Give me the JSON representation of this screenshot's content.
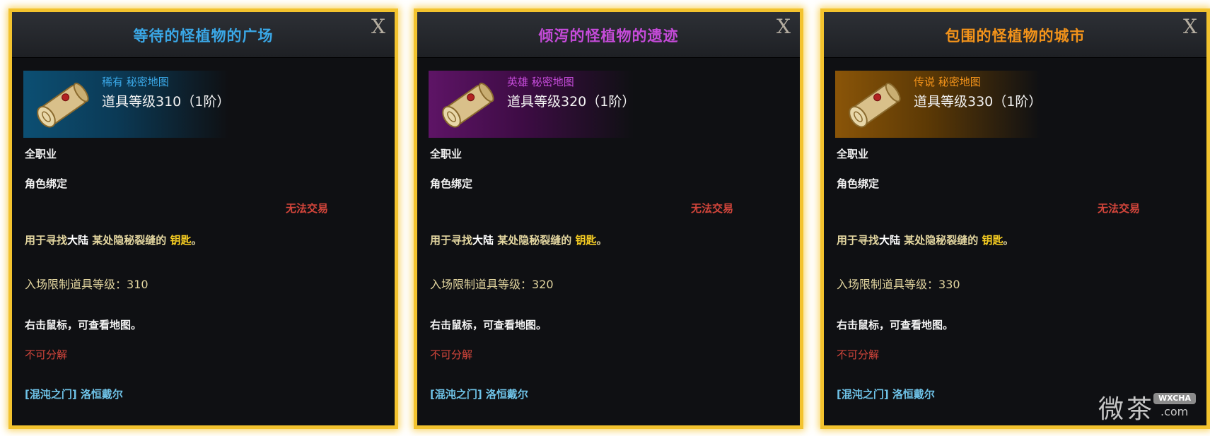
{
  "colors": {
    "frame": "#f3c32e",
    "panel_bg": "#0f1013",
    "rare": "#3aa7e6",
    "heroic": "#c54bd9",
    "legendary": "#f3931a",
    "untradeable": "#d2453b",
    "highlight": "#f5cc22",
    "location": "#6fc3e8"
  },
  "cards": [
    {
      "title": "等待的怪植物的广场",
      "title_color": "#3aa7e6",
      "close_label": "X",
      "icon": "scroll-icon",
      "rarity": "稀有",
      "rarity_color": "#3aa7e6",
      "type": "秘密地图",
      "item_level": "道具等级310（1阶）",
      "class": "全职业",
      "binding": "角色绑定",
      "trade": "无法交易",
      "desc_prefix": "用于寻找",
      "desc_place": "大陆",
      "desc_middle": " 某处隐秘裂缝的 ",
      "desc_key": "钥匙",
      "desc_suffix": "。",
      "entry_label": "入场限制道具等级：",
      "entry_value": "310",
      "right_click": "右击鼠标，可查看地图。",
      "dismantle": "不可分解",
      "location": "[混沌之门] 洛恒戴尔"
    },
    {
      "title": "倾泻的怪植物的遗迹",
      "title_color": "#c54bd9",
      "close_label": "X",
      "icon": "scroll-icon",
      "rarity": "英雄",
      "rarity_color": "#c54bd9",
      "type": "秘密地图",
      "item_level": "道具等级320（1阶）",
      "class": "全职业",
      "binding": "角色绑定",
      "trade": "无法交易",
      "desc_prefix": "用于寻找",
      "desc_place": "大陆",
      "desc_middle": " 某处隐秘裂缝的 ",
      "desc_key": "钥匙",
      "desc_suffix": "。",
      "entry_label": "入场限制道具等级：",
      "entry_value": "320",
      "right_click": "右击鼠标，可查看地图。",
      "dismantle": "不可分解",
      "location": "[混沌之门] 洛恒戴尔"
    },
    {
      "title": "包围的怪植物的城市",
      "title_color": "#f3931a",
      "close_label": "X",
      "icon": "scroll-icon",
      "rarity": "传说",
      "rarity_color": "#f3931a",
      "type": "秘密地图",
      "item_level": "道具等级330（1阶）",
      "class": "全职业",
      "binding": "角色绑定",
      "trade": "无法交易",
      "desc_prefix": "用于寻找",
      "desc_place": "大陆",
      "desc_middle": " 某处隐秘裂缝的 ",
      "desc_key": "钥匙",
      "desc_suffix": "。",
      "entry_label": "入场限制道具等级：",
      "entry_value": "330",
      "right_click": "右击鼠标，可查看地图。",
      "dismantle": "不可分解",
      "location": "[混沌之门] 洛恒戴尔"
    }
  ],
  "watermark": {
    "text": "微茶",
    "badge": "WXCHA",
    "domain": ".com"
  }
}
